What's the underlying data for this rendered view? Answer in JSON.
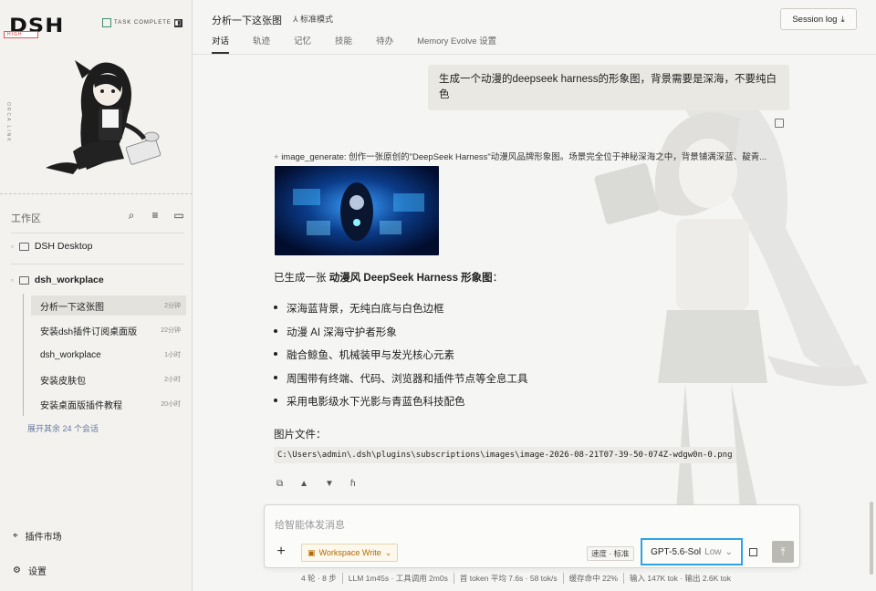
{
  "app": {
    "brand": "DSH",
    "risk_tag": "HIGH",
    "status_badge": "TASK COMPLETE",
    "side_vertical": "ORCA LINK"
  },
  "sidebar": {
    "workspace_title": "工作区",
    "folders": [
      {
        "label": "DSH Desktop"
      },
      {
        "label": "dsh_workplace"
      }
    ],
    "sessions": [
      {
        "title": "分析一下这张图",
        "time": "2分钟"
      },
      {
        "title": "安装dsh插件订阅桌面版",
        "time": "22分钟"
      },
      {
        "title": "dsh_workplace",
        "time": "1小时"
      },
      {
        "title": "安装皮肤包",
        "time": "2小时"
      },
      {
        "title": "安装桌面版插件教程",
        "time": "20小时"
      }
    ],
    "more": "展开其余 24 个会话",
    "plugin_market": "插件市场",
    "settings": "设置"
  },
  "header": {
    "title": "分析一下这张图",
    "mode": "标准模式",
    "tabs": [
      "对话",
      "轨迹",
      "记忆",
      "技能",
      "待办",
      "Memory Evolve 设置"
    ],
    "session_log": "Session log"
  },
  "chat": {
    "user_message": "生成一个动漫的deepseek harness的形象图，背景需要是深海，不要纯白色",
    "tool_call": "image_generate: 创作一张原创的\"DeepSeek Harness\"动漫风品牌形象图。场景完全位于神秘深海之中，背景铺满深蓝、靛青...",
    "answer_prefix": "已生成一张 ",
    "answer_bold": "动漫风 DeepSeek Harness 形象图",
    "answer_suffix": "：",
    "bullets": [
      "深海蓝背景，无纯白底与白色边框",
      "动漫 AI 深海守护者形象",
      "融合鲸鱼、机械装甲与发光核心元素",
      "周围带有终端、代码、浏览器和插件节点等全息工具",
      "采用电影级水下光影与青蓝色科技配色"
    ],
    "file_label": "图片文件：",
    "file_path": "C:\\Users\\admin\\.dsh\\plugins\\subscriptions\\images\\image-2026-08-21T07-39-50-074Z-wdgw0n-0.png"
  },
  "composer": {
    "placeholder": "给智能体发消息",
    "workspace": "Workspace Write",
    "speed": "速度 · 标准",
    "model": "GPT-5.6-Sol",
    "level": "Low"
  },
  "status_bar": [
    "4 轮 · 8 步",
    "LLM 1m45s · 工具调用 2m0s",
    "首 token 平均 7.6s · 58 tok/s",
    "缓存命中 22%",
    "输入 147K tok · 输出 2.6K tok"
  ],
  "colors": {
    "accent": "#2fa3e8",
    "workspace": "#b26a00"
  }
}
